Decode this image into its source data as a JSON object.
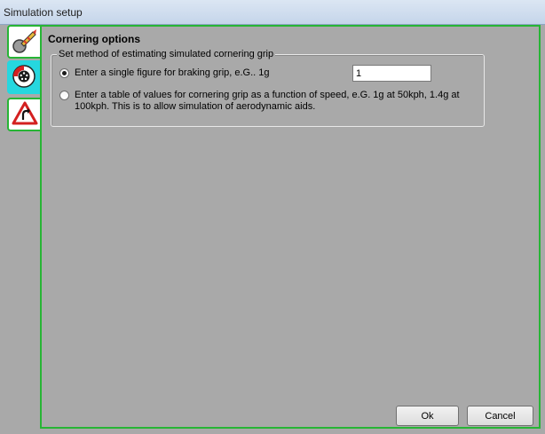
{
  "window": {
    "title": "Simulation setup"
  },
  "tabs": [
    {
      "icon": "rocket-icon"
    },
    {
      "icon": "brake-disc-icon"
    },
    {
      "icon": "bend-warning-sign-icon"
    }
  ],
  "panel": {
    "title": "Cornering options",
    "group_label": "Set method of estimating simulated cornering grip",
    "options": [
      {
        "label": "Enter a single figure for braking grip, e.G.. 1g",
        "checked": true
      },
      {
        "label": "Enter a table of values for cornering grip as a function of speed, e.G. 1g at 50kph, 1.4g at 100kph. This is to allow simulation of aerodynamic aids.",
        "checked": false
      }
    ],
    "grip_value": "1"
  },
  "buttons": {
    "ok": "Ok",
    "cancel": "Cancel"
  },
  "colors": {
    "selected_tab_border": "#27b535",
    "active_tab_bg": "#26d7df",
    "background": "#a9a9a9"
  }
}
